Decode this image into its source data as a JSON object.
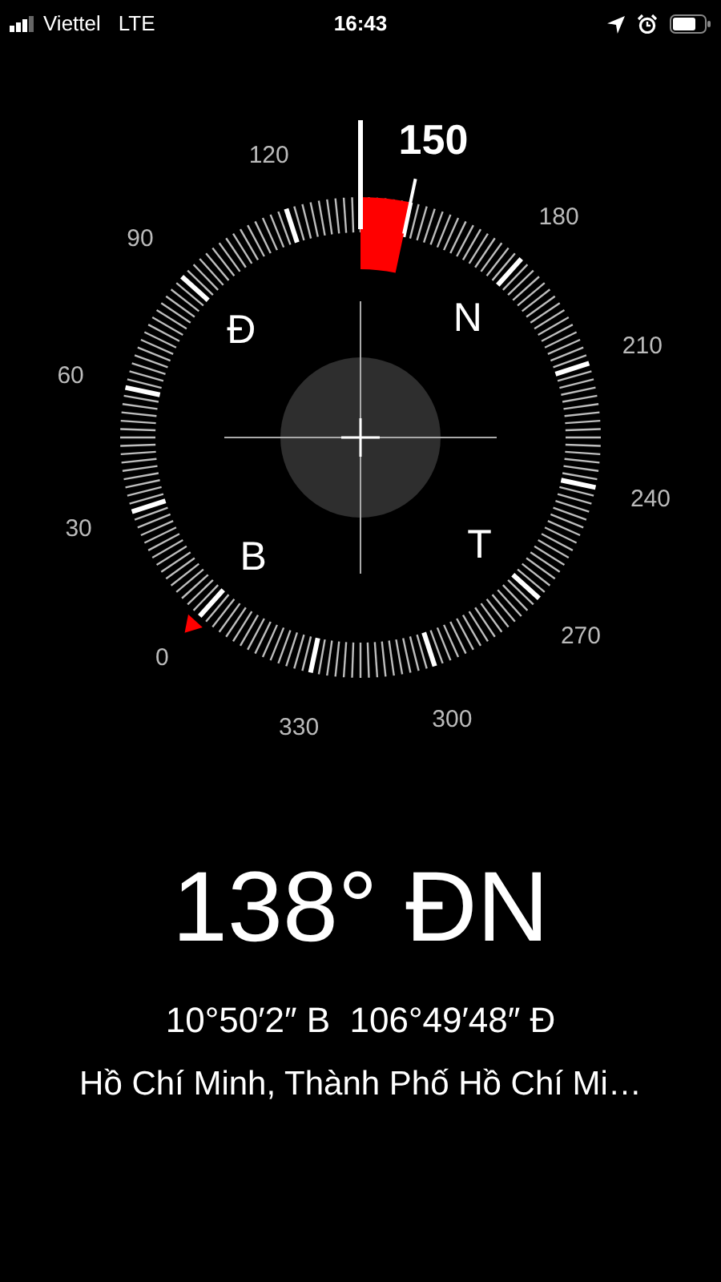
{
  "status_bar": {
    "carrier": "Viettel",
    "network": "LTE",
    "time": "16:43"
  },
  "compass": {
    "degree_labels": [
      {
        "text": "0",
        "selected": false
      },
      {
        "text": "30",
        "selected": false
      },
      {
        "text": "60",
        "selected": false
      },
      {
        "text": "90",
        "selected": false
      },
      {
        "text": "120",
        "selected": false
      },
      {
        "text": "150",
        "selected": true
      },
      {
        "text": "180",
        "selected": false
      },
      {
        "text": "210",
        "selected": false
      },
      {
        "text": "240",
        "selected": false
      },
      {
        "text": "270",
        "selected": false
      },
      {
        "text": "300",
        "selected": false
      },
      {
        "text": "330",
        "selected": false
      }
    ],
    "cardinals": [
      "Đ",
      "N",
      "B",
      "T"
    ]
  },
  "heading": "138° ĐN",
  "coordinates": "10°50′2″ B  106°49′48″ Đ",
  "place": "Hồ Chí Minh, Thành Phố Hồ Chí Mi…"
}
